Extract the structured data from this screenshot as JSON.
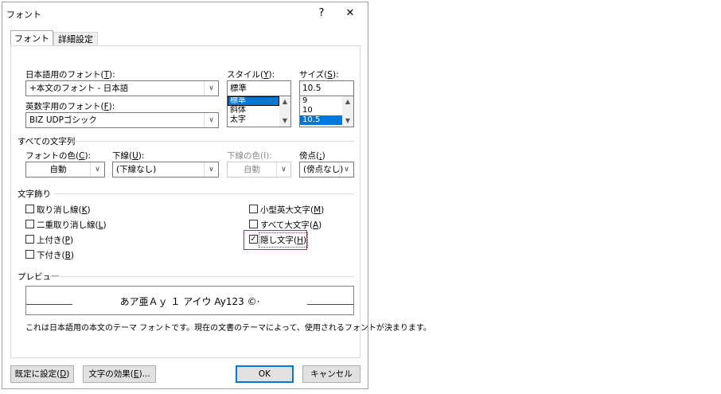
{
  "dialog": {
    "title": "フォント",
    "help": "?",
    "close": "✕"
  },
  "tabs": [
    {
      "label": "フォント",
      "active": true
    },
    {
      "label": "詳細設定",
      "active": false
    }
  ],
  "font_jp": {
    "label_pre": "日本語用のフォント(",
    "key": "T",
    "label_post": "):",
    "value": "+本文のフォント - 日本語"
  },
  "font_en": {
    "label_pre": "英数字用のフォント(",
    "key": "F",
    "label_post": "):",
    "value": "BIZ UDPゴシック"
  },
  "style": {
    "label_pre": "スタイル(",
    "key": "Y",
    "label_post": "):",
    "value": "標準",
    "options": [
      "標準",
      "斜体",
      "太字"
    ],
    "selected": "標準"
  },
  "size": {
    "label_pre": "サイズ(",
    "key": "S",
    "label_post": "):",
    "value": "10.5",
    "options": [
      "9",
      "10",
      "10.5"
    ],
    "selected": "10.5"
  },
  "all_text": {
    "section": "すべての文字列",
    "font_color": {
      "label_pre": "フォントの色(",
      "key": "C",
      "label_post": "):",
      "value": "自動"
    },
    "underline": {
      "label_pre": "下線(",
      "key": "U",
      "label_post": "):",
      "value": "(下線なし)"
    },
    "underline_color": {
      "label": "下線の色(I):",
      "value": "自動"
    },
    "emphasis": {
      "label_pre": "傍点(",
      "key": ";",
      "label_post": ")",
      "value": "(傍点なし)"
    }
  },
  "effects": {
    "section": "文字飾り",
    "items": [
      {
        "label_pre": "取り消し線(",
        "key": "K",
        "label_post": ")",
        "checked": false
      },
      {
        "label_pre": "二重取り消し線(",
        "key": "L",
        "label_post": ")",
        "checked": false
      },
      {
        "label_pre": "上付き(",
        "key": "P",
        "label_post": ")",
        "checked": false
      },
      {
        "label_pre": "下付き(",
        "key": "B",
        "label_post": ")",
        "checked": false
      },
      {
        "label_pre": "小型英大文字(",
        "key": "M",
        "label_post": ")",
        "checked": false
      },
      {
        "label_pre": "すべて大文字(",
        "key": "A",
        "label_post": ")",
        "checked": false
      },
      {
        "label_pre": "隠し文字(",
        "key": "H",
        "label_post": ")",
        "checked": true
      }
    ]
  },
  "preview": {
    "section": "プレビュー",
    "sample": "あア亜Ａｙ １ アイウ Ay123 ©·",
    "note": "これは日本語用の本文のテーマ フォントです。現在の文書のテーマによって、使用されるフォントが決まります。"
  },
  "buttons": {
    "default": {
      "label_pre": "既定に設定(",
      "key": "D",
      "label_post": ")"
    },
    "text_effects": {
      "label_pre": "文字の効果(",
      "key": "E",
      "label_post": ")..."
    },
    "ok": "OK",
    "cancel": "キャンセル"
  },
  "colors": {
    "selection": "#0078d7",
    "highlight_border": "#a0306a",
    "default_button_border": "#0078d7"
  }
}
